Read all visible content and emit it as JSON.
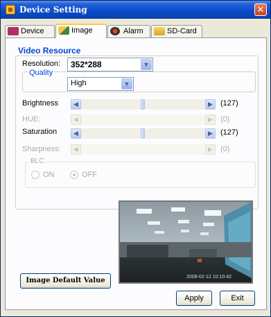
{
  "window": {
    "title": "Device Setting",
    "close_glyph": "✕"
  },
  "tabs": [
    {
      "label": "Device",
      "icon": "device-icon",
      "active": false
    },
    {
      "label": "Image",
      "icon": "image-icon",
      "active": true
    },
    {
      "label": "Alarm",
      "icon": "alarm-icon",
      "active": false
    },
    {
      "label": "SD-Card",
      "icon": "sd-card-icon",
      "active": false
    }
  ],
  "video_resource": {
    "title": "Video Resource",
    "resolution_label": "Resolution:",
    "resolution_value": "352*288",
    "quality_label": "Quality",
    "quality_value": "High"
  },
  "sliders": [
    {
      "label": "Brightness",
      "value_text": "(127)",
      "value": 127,
      "max": 255,
      "enabled": true
    },
    {
      "label": "HUE:",
      "value_text": "(0)",
      "value": 0,
      "max": 255,
      "enabled": false
    },
    {
      "label": "Saturation",
      "value_text": "(127)",
      "value": 127,
      "max": 255,
      "enabled": true
    },
    {
      "label": "Sharpness:",
      "value_text": "(0)",
      "value": 0,
      "max": 255,
      "enabled": false
    }
  ],
  "blc": {
    "title": "BLC",
    "on_label": "ON",
    "off_label": "OFF",
    "selected": "OFF"
  },
  "preview": {
    "timestamp": "2008-02-12 10:10:42"
  },
  "buttons": {
    "default_label": "Image Default Value",
    "apply_label": "Apply",
    "exit_label": "Exit"
  },
  "colors": {
    "title_bar": "#0a4cc8",
    "group_title": "#0046d5",
    "active_tab_accent": "#ffc83c"
  }
}
